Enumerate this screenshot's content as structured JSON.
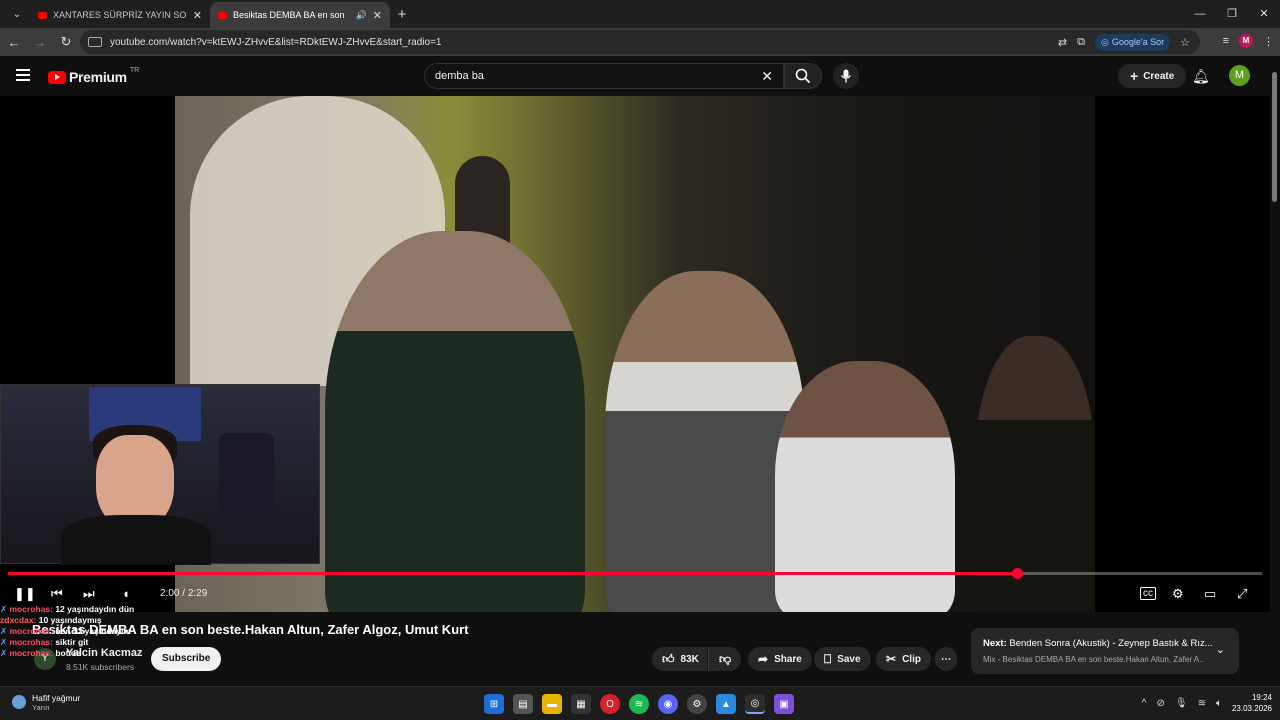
{
  "browser": {
    "tabs": [
      {
        "title": "XANTARES SÜRPRİZ YAYIN SOR",
        "close": "✕"
      },
      {
        "title": "Besiktas DEMBA BA en son",
        "close": "✕",
        "audio": "🔊"
      }
    ],
    "new_tab": "+",
    "window_controls": {
      "minimize": "—",
      "maximize": "❐",
      "close": "✕"
    },
    "url": "youtube.com/watch?v=ktEWJ-ZHvvE&list=RDktEWJ-ZHvvE&start_radio=1",
    "google_sor": "Google'a Sor",
    "profile_initial": "M"
  },
  "header": {
    "logo": "Premium",
    "country": "TR",
    "search_query": "demba ba",
    "create_label": "Create",
    "avatar_initial": "M"
  },
  "player": {
    "current_time": "2:00",
    "separator": " / ",
    "duration": "2:29",
    "progress": 0.805
  },
  "chat": [
    {
      "user": "mocrohas:",
      "text": "12 yaşındaydın dün"
    },
    {
      "user": "zdxcdax:",
      "text": "10 yaşındaymış"
    },
    {
      "user": "mocrohas:",
      "text": "ben 13 yaşındayım"
    },
    {
      "user": "mocrohas:",
      "text": "siktir git"
    },
    {
      "user": "mocrohas:",
      "text": "bot oe"
    }
  ],
  "video": {
    "title": "Besiktas DEMBA BA en son beste.Hakan Altun, Zafer Algoz, Umut Kurt",
    "channel_initial": "Y",
    "channel": "Yalcin Kacmaz",
    "subscribers": "8.51K subscribers",
    "subscribe_label": "Subscribe",
    "likes": "83K",
    "share_label": "Share",
    "save_label": "Save",
    "clip_label": "Clip"
  },
  "next": {
    "prefix": "Next:",
    "title": "Benden Sonra (Akustik) - Zeynep Bastık & Rız...",
    "subtitle": "Mix - Besiktas DEMBA BA en son beste.Hakan Altun, Zafer A..."
  },
  "taskbar": {
    "weather_title": "Hafif yağmur",
    "weather_sub": "Yarın",
    "time": "19:24",
    "date": "23.03.2026"
  },
  "colors": {
    "accent": "#ff0033",
    "brand": "#ff0000"
  }
}
